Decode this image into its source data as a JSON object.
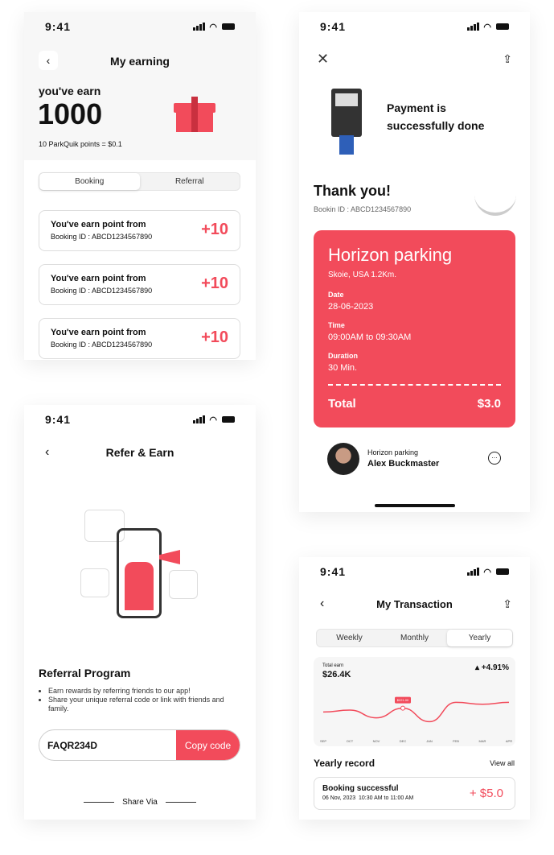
{
  "status": {
    "time": "9:41"
  },
  "earning": {
    "title": "My earning",
    "earn_label": "you've earn",
    "points": "1000",
    "rate": "10 ParkQuik points = $0.1",
    "tabs": [
      "Booking",
      "Referral"
    ],
    "items": [
      {
        "title": "You've earn point from",
        "booking": "Booking ID : ABCD1234567890",
        "points": "+10"
      },
      {
        "title": "You've earn point from",
        "booking": "Booking ID : ABCD1234567890",
        "points": "+10"
      },
      {
        "title": "You've earn point from",
        "booking": "Booking ID : ABCD1234567890",
        "points": "+10"
      }
    ]
  },
  "payment": {
    "message": "Payment is successfully done",
    "thanks": "Thank you!",
    "booking_id": "Bookin ID : ABCD1234567890",
    "place": "Horizon parking",
    "location": "Skoie, USA 1.2Km.",
    "date_label": "Date",
    "date": "28-06-2023",
    "time_label": "Time",
    "time": "09:00AM to 09:30AM",
    "duration_label": "Duration",
    "duration": "30 Min.",
    "total_label": "Total",
    "total": "$3.0",
    "host_place": "Horizon parking",
    "host_name": "Alex Buckmaster"
  },
  "refer": {
    "title": "Refer & Earn",
    "program_title": "Referral Program",
    "bullets": [
      "Earn rewards by referring friends to our app!",
      "Share your unique referral code or link with friends and family."
    ],
    "code": "FAQR234D",
    "copy_label": "Copy code",
    "share_via": "Share Via"
  },
  "transaction": {
    "title": "My Transaction",
    "tabs": [
      "Weekly",
      "Monthly",
      "Yearly"
    ],
    "active_tab": "Yearly",
    "total_label": "Total earn",
    "total": "$26.4K",
    "change": "+4.91%",
    "section": "Yearly record",
    "view_all": "View all",
    "record": {
      "title": "Booking successful",
      "date": "06 Nov, 2023  10:30 AM to 11:00 AM",
      "amount": "+ $5.0"
    }
  },
  "chart_data": {
    "type": "line",
    "categories": [
      "SEP",
      "OCT",
      "NOV",
      "DEC",
      "JAN",
      "FEB",
      "MAR",
      "APR"
    ],
    "series": [
      {
        "values": [
          0.45,
          0.5,
          0.3,
          0.55,
          0.2,
          0.7,
          0.65,
          0.7
        ]
      }
    ],
    "annotation": "$221.00",
    "grid": false
  },
  "colors": {
    "accent": "#f24b5b"
  }
}
